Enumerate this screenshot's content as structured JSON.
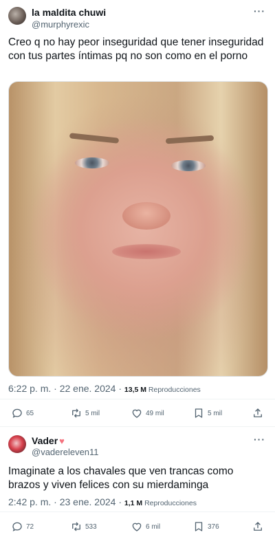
{
  "tweets": [
    {
      "author": {
        "name": "la maldita chuwi",
        "handle": "@murphyrexic"
      },
      "text": "Creo q no hay peor inseguridad que tener inseguridad con tus partes íntimas pq no son como en el porno",
      "timestamp": "6:22 p. m. · 22 ene. 2024 · ",
      "views_count": "13,5 M",
      "views_label": " Reproducciones",
      "stats": {
        "replies": "65",
        "retweets": "5 mil",
        "likes": "49 mil",
        "bookmarks": "5 mil"
      }
    },
    {
      "author": {
        "name": "Vader",
        "handle": "@vadereleven11"
      },
      "name_emoji": "♥",
      "text": "Imaginate a los chavales que ven trancas como brazos y viven felices con su mierdaminga",
      "timestamp": "2:42 p. m. · 23 ene. 2024 · ",
      "views_count": "1,1 M",
      "views_label": " Reproducciones",
      "stats": {
        "replies": "72",
        "retweets": "533",
        "likes": "6 mil",
        "bookmarks": "376"
      }
    }
  ],
  "more_glyph": "···",
  "colors": {
    "text": "#0f1419",
    "secondary": "#536471",
    "heart": "#f4727e",
    "divider": "#eff3f4"
  },
  "icons": [
    "reply-icon",
    "retweet-icon",
    "like-icon",
    "bookmark-icon",
    "share-icon",
    "more-icon"
  ]
}
